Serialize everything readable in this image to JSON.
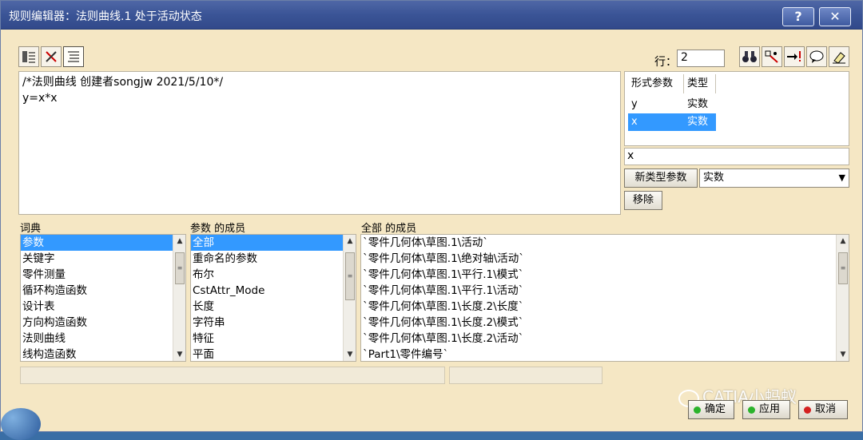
{
  "window": {
    "title": "规则编辑器：法则曲线.1 处于活动状态",
    "help_label": "?",
    "close_label": "✕"
  },
  "toolbar": {
    "left_icons": [
      "dictionary-toggle-icon",
      "cross-toggle-icon",
      "text-list-icon"
    ],
    "right_icons": [
      "binoculars-icon",
      "measure-icon",
      "arrow-alert-icon",
      "comment-icon",
      "eraser-icon"
    ],
    "row_label": "行：",
    "row_value": "2"
  },
  "editor": {
    "lines": [
      "/*法则曲线 创建者songjw 2021/5/10*/",
      "y=x*x"
    ]
  },
  "params": {
    "headers": [
      "形式参数",
      "类型"
    ],
    "rows": [
      {
        "name": "y",
        "type": "实数",
        "selected": false
      },
      {
        "name": "x",
        "type": "实数",
        "selected": true
      }
    ],
    "name_value": "x",
    "new_type_label": "新类型参数",
    "type_selected": "实数",
    "remove_label": "移除"
  },
  "lists": {
    "dict_title": "词典",
    "dict_items": [
      "参数",
      "关键字",
      "零件测量",
      "循环构造函数",
      "设计表",
      "方向构造函数",
      "法则曲线",
      "线构造函数"
    ],
    "members_title": "参数 的成员",
    "members_items": [
      "全部",
      "重命名的参数",
      "布尔",
      "CstAttr_Mode",
      "长度",
      "字符串",
      "特征",
      "平面"
    ],
    "all_title": "全部 的成员",
    "all_items": [
      "`零件几何体\\草图.1\\活动`",
      "`零件几何体\\草图.1\\绝对轴\\活动`",
      "`零件几何体\\草图.1\\平行.1\\模式`",
      "`零件几何体\\草图.1\\平行.1\\活动`",
      "`零件几何体\\草图.1\\长度.2\\长度`",
      "`零件几何体\\草图.1\\长度.2\\模式`",
      "`零件几何体\\草图.1\\长度.2\\活动`",
      "`Part1\\零件编号`"
    ]
  },
  "watermark": "CATIA小蚂蚁",
  "buttons": {
    "ok": "确定",
    "apply": "应用",
    "cancel": "取消"
  },
  "colors": {
    "title_bar": "#3a5496",
    "dialog_bg": "#f5e7c4",
    "selection": "#3399ff",
    "ok_dot": "#2bb32b",
    "apply_dot": "#2bb32b",
    "cancel_dot": "#d42020"
  }
}
